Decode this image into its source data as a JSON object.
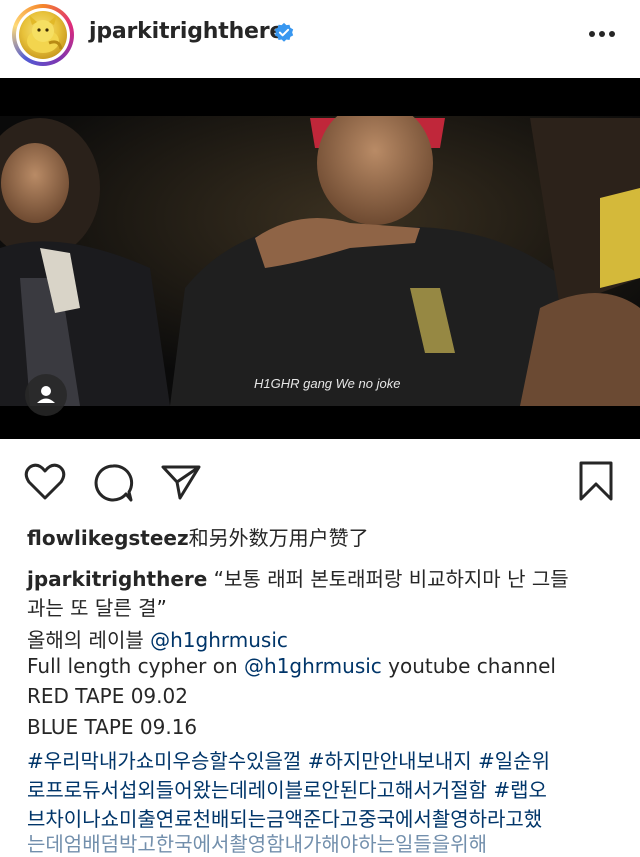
{
  "post": {
    "username": "jparkitrighthere",
    "video_subtitle": "H1GHR gang We no joke"
  },
  "likes": {
    "user": "flowlikegsteez",
    "suffix": "和另外数万用户赞了"
  },
  "caption": {
    "username": "jparkitrighthere",
    "line1": "“보통 래퍼 본토래퍼랑 비교하지마 난 그들",
    "line2": "과는 또 달른 결”",
    "line3_prefix": "올해의 레이블 ",
    "line3_mention": "@h1ghrmusic",
    "line4_prefix": "Full length cypher on ",
    "line4_mention": "@h1ghrmusic",
    "line4_suffix": "  youtube channel",
    "line5": "RED TAPE 09.02",
    "line6": "BLUE TAPE 09.16",
    "hashtags_line1": "#우리막내가쇼미우승할수있을껄 #하지만안내보내지 #일순위",
    "hashtags_line2": "로프로듀서섭외들어왔는데레이블로안된다고해서거절함 #랩오",
    "hashtags_line3": "브차이나쇼미출연료천배되는금액준다고중국에서촬영하라고했",
    "hashtags_line4": "는데엄배덤박고한국에서촬영함내가해야하는일들을위해"
  },
  "icons": {
    "like": "heart-icon",
    "comment": "comment-icon",
    "share": "paper-plane-icon",
    "save": "bookmark-icon",
    "more": "more-dots-icon",
    "verified": "verified-badge-icon",
    "tag": "user-tag-icon"
  },
  "colors": {
    "text": "#262626",
    "link": "#003569",
    "verified": "#3897f0"
  }
}
